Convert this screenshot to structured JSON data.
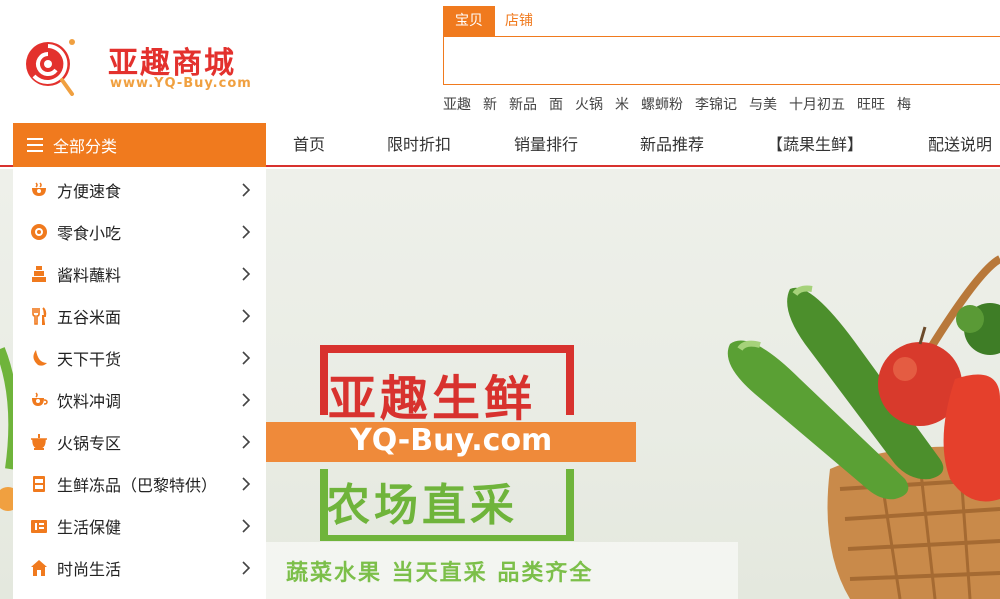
{
  "logo": {
    "name": "亚趣商城",
    "url": "www.YQ-Buy.com"
  },
  "search": {
    "tabs": [
      "宝贝",
      "店铺"
    ],
    "active_tab": "宝贝",
    "value": "",
    "placeholder": ""
  },
  "hot_words": [
    "亚趣",
    "新",
    "新品",
    "面",
    "火锅",
    "米",
    "螺蛳粉",
    "李锦记",
    "与美",
    "十月初五",
    "旺旺",
    "梅"
  ],
  "nav": {
    "all_categories": "全部分类",
    "items": [
      "首页",
      "限时折扣",
      "销量排行",
      "新品推荐",
      "【蔬果生鲜】",
      "配送说明"
    ]
  },
  "categories": [
    {
      "label": "方便速食",
      "icon": "bowl-icon"
    },
    {
      "label": "零食小吃",
      "icon": "snack-icon"
    },
    {
      "label": "酱料蘸料",
      "icon": "sauce-icon"
    },
    {
      "label": "五谷米面",
      "icon": "utensils-icon"
    },
    {
      "label": "天下干货",
      "icon": "moon-icon"
    },
    {
      "label": "饮料冲调",
      "icon": "cup-icon"
    },
    {
      "label": "火锅专区",
      "icon": "hotpot-icon"
    },
    {
      "label": "生鲜冻品（巴黎特供）",
      "icon": "fridge-icon"
    },
    {
      "label": "生活保健",
      "icon": "health-icon"
    },
    {
      "label": "时尚生活",
      "icon": "home-icon"
    }
  ],
  "banner": {
    "title": "亚趣生鲜",
    "url": "YQ-Buy.com",
    "subtitle": "农场直采",
    "slogan": "蔬菜水果 当天直采 品类齐全"
  },
  "colors": {
    "accent": "#f07a1e",
    "brand_red": "#d8322e",
    "green": "#6fb43b"
  }
}
